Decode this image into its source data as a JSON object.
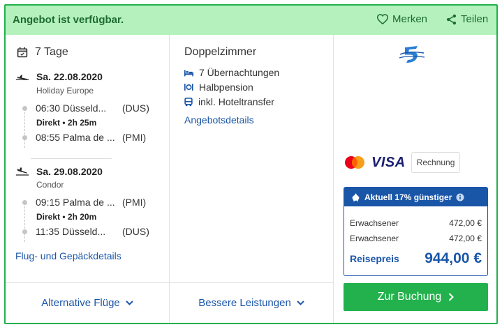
{
  "header": {
    "status": "Angebot ist verfügbar.",
    "save_label": "Merken",
    "share_label": "Teilen"
  },
  "trip": {
    "duration": "7 Tage",
    "outbound": {
      "date": "Sa. 22.08.2020",
      "airline": "Holiday Europe",
      "dep_time_city": "06:30 Düsseld...",
      "dep_code": "(DUS)",
      "direct": "Direkt",
      "duration": "2h 25m",
      "arr_time_city": "08:55 Palma de ...",
      "arr_code": "(PMI)"
    },
    "return": {
      "date": "Sa. 29.08.2020",
      "airline": "Condor",
      "dep_time_city": "09:15 Palma de ...",
      "dep_code": "(PMI)",
      "direct": "Direkt",
      "duration": "2h 20m",
      "arr_time_city": "11:35 Düsseld...",
      "arr_code": "(DUS)"
    },
    "flight_details_link": "Flug- und Gepäckdetails"
  },
  "hotel": {
    "room": "Doppelzimmer",
    "features": [
      {
        "icon": "bed-icon",
        "label": "7 Übernachtungen"
      },
      {
        "icon": "meal-icon",
        "label": "Halbpension"
      },
      {
        "icon": "bus-icon",
        "label": "inkl. Hoteltransfer"
      }
    ],
    "details_link": "Angebotsdetails"
  },
  "payment": {
    "visa": "VISA",
    "invoice": "Rechnung"
  },
  "price": {
    "badge": "Aktuell 17% günstiger",
    "rows": [
      {
        "label": "Erwachsener",
        "value": "472,00 €"
      },
      {
        "label": "Erwachsener",
        "value": "472,00 €"
      }
    ],
    "total_label": "Reisepreis",
    "total_value": "944,00 €"
  },
  "buttons": {
    "alt_flights": "Alternative Flüge",
    "better_services": "Bessere Leistungen",
    "book": "Zur Buchung"
  },
  "colors": {
    "accent_green": "#22b14c",
    "header_green": "#b5f1bd",
    "link_blue": "#1a56a8"
  }
}
